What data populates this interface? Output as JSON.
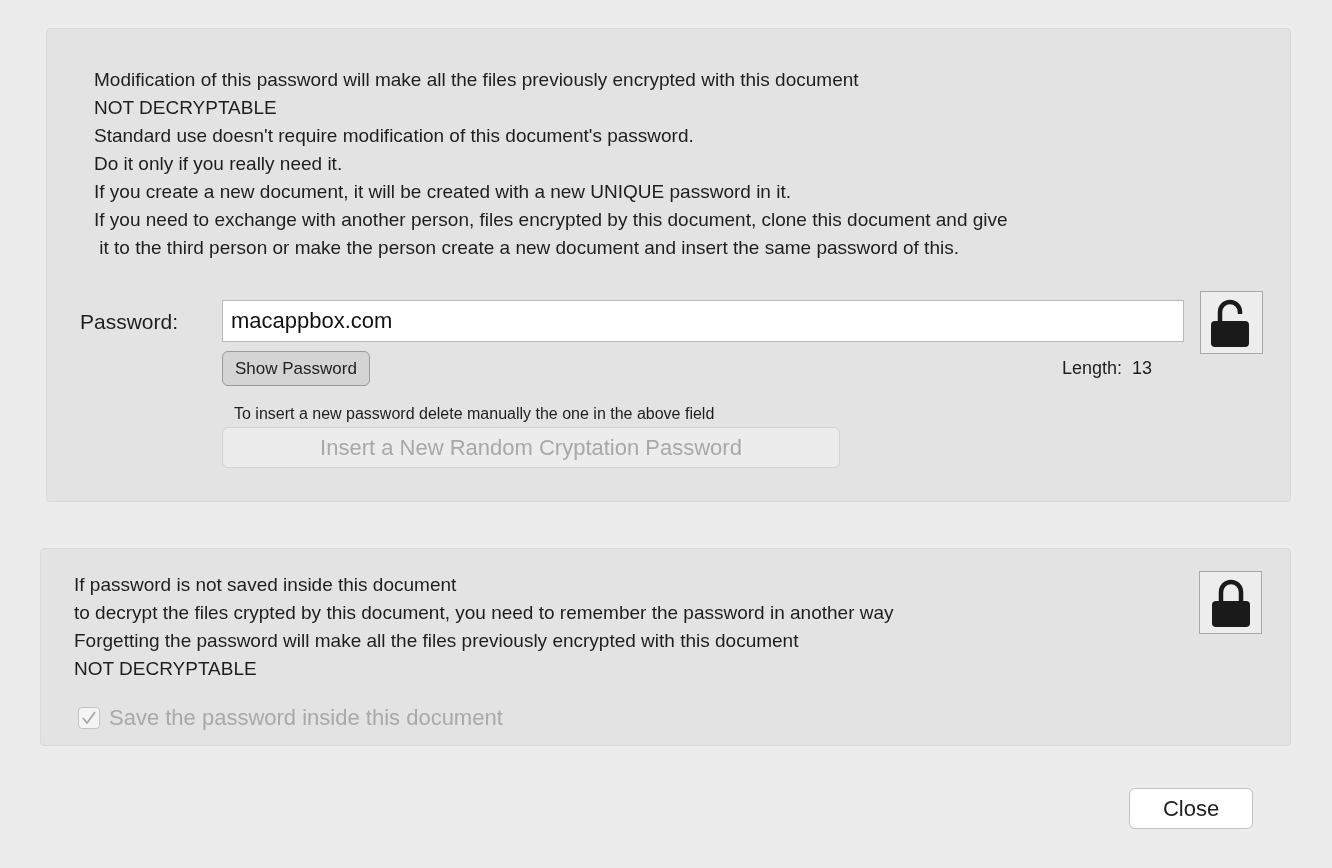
{
  "warning_lines": [
    "Modification of this password will make all the files previously encrypted with this document",
    "NOT DECRYPTABLE",
    "Standard use doesn't require modification of this document's password.",
    "Do it only if you really need it.",
    "If you create a new document, it will be created with a new UNIQUE password in it.",
    "If you need to exchange with another person, files encrypted by this document, clone this document and give",
    " it to the third person or make the person create a new document and insert the same password of this."
  ],
  "password": {
    "label": "Password:",
    "value": "macappbox.com",
    "lock": {
      "kind": "open"
    },
    "show_button": "Show Password",
    "length_label": "Length:",
    "length_value": "13",
    "hint": "To insert a new password delete manually the one in the above field",
    "random_button": {
      "label": "Insert a New Random Cryptation Password",
      "disabled": true
    }
  },
  "save_section": {
    "lines": [
      "If password is not saved inside this document",
      "to decrypt the files crypted by this document, you need to remember the password in another way",
      "Forgetting the password will make all the files previously encrypted with this document",
      "NOT DECRYPTABLE"
    ],
    "lock": {
      "kind": "closed"
    },
    "checkbox": {
      "label": "Save the password inside this document",
      "checked": true,
      "disabled": true
    }
  },
  "close_button": "Close"
}
